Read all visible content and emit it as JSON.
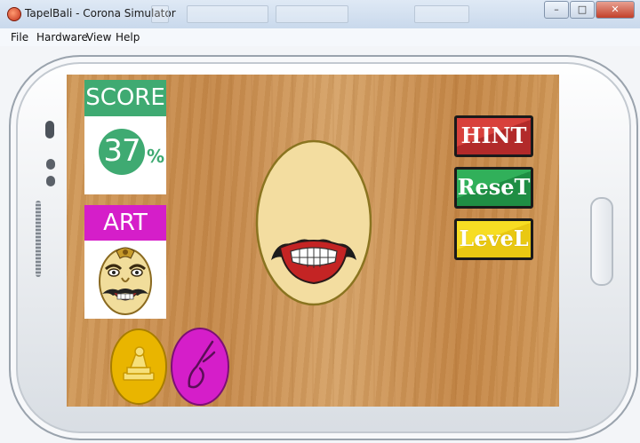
{
  "window": {
    "title": "TapelBali - Corona Simulator",
    "controls": {
      "minimize": "–",
      "maximize": "□",
      "close": "✕"
    }
  },
  "menu": {
    "items": [
      {
        "label": "File"
      },
      {
        "label": "Hardware"
      },
      {
        "label": "View"
      },
      {
        "label": "Help"
      }
    ]
  },
  "game": {
    "score": {
      "title": "SCORE",
      "value": "37",
      "unit": "%"
    },
    "art": {
      "title": "ART"
    },
    "buttons": {
      "hint": "HINT",
      "reset": "ReseT",
      "level": "LeveL"
    },
    "tools": [
      "stamp-icon",
      "brush-icon"
    ]
  },
  "colors": {
    "score_green": "#3faa72",
    "art_magenta": "#d51ec9",
    "hint_red": "#c0302c",
    "reset_green": "#26a04d",
    "level_yellow": "#f0d21a",
    "tool_yellow": "#e9b500",
    "tool_magenta": "#d51ec9",
    "face_fill": "#f3dda0",
    "wood": "#cf9555"
  }
}
